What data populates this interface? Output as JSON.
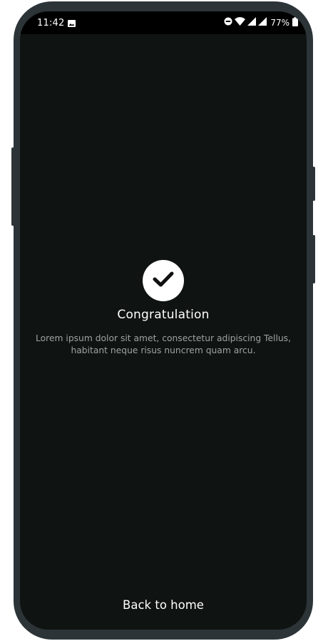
{
  "status_bar": {
    "time": "11:42",
    "battery_percent": "77%",
    "icons": [
      "image-icon",
      "do-not-disturb-icon",
      "wifi-icon",
      "signal-icon",
      "signal-icon",
      "battery-icon"
    ]
  },
  "main": {
    "icon": "check-icon",
    "title": "Congratulation",
    "description": "Lorem ipsum dolor sit amet, consectetur adipiscing Tellus, habitant neque risus nuncrem quam arcu."
  },
  "footer": {
    "back_label": "Back to home"
  },
  "colors": {
    "background": "#0f1311",
    "device_frame": "#2c3438",
    "text_primary": "#ffffff",
    "text_secondary": "#9ea3a1"
  }
}
